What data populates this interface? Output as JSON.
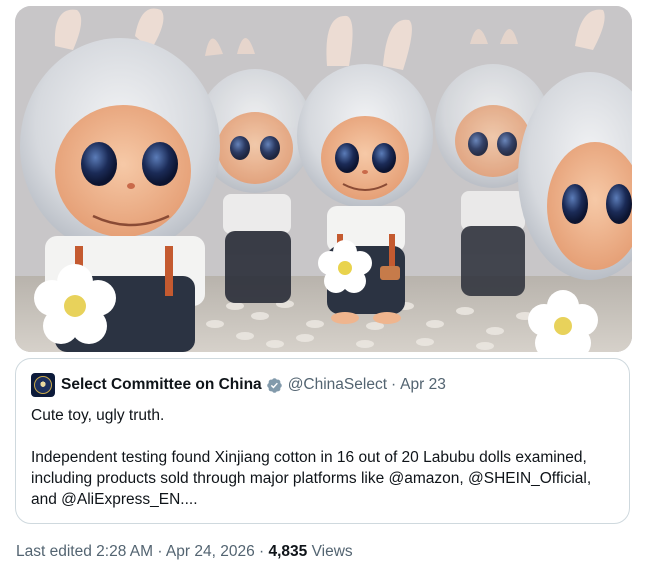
{
  "photo": {
    "alt": "Labubu dolls"
  },
  "quoted_tweet": {
    "author_name": "Select Committee on China",
    "handle": "@ChinaSelect",
    "separator": "·",
    "date": "Apr 23",
    "text": "Cute toy, ugly truth.\n\nIndependent testing found Xinjiang cotton in 16 out of 20 Labubu dolls examined, including products sold through major platforms like @amazon, @SHEIN_Official, and @AliExpress_EN....",
    "verified_color": "#829aab"
  },
  "meta": {
    "edited_label": "Last edited 2:28 AM · Apr 24, 2026",
    "separator": "·",
    "views_count": "4,835",
    "views_label": "Views"
  },
  "colors": {
    "text_primary": "#0f1419",
    "text_secondary": "#536471",
    "border": "#cfd9de"
  }
}
